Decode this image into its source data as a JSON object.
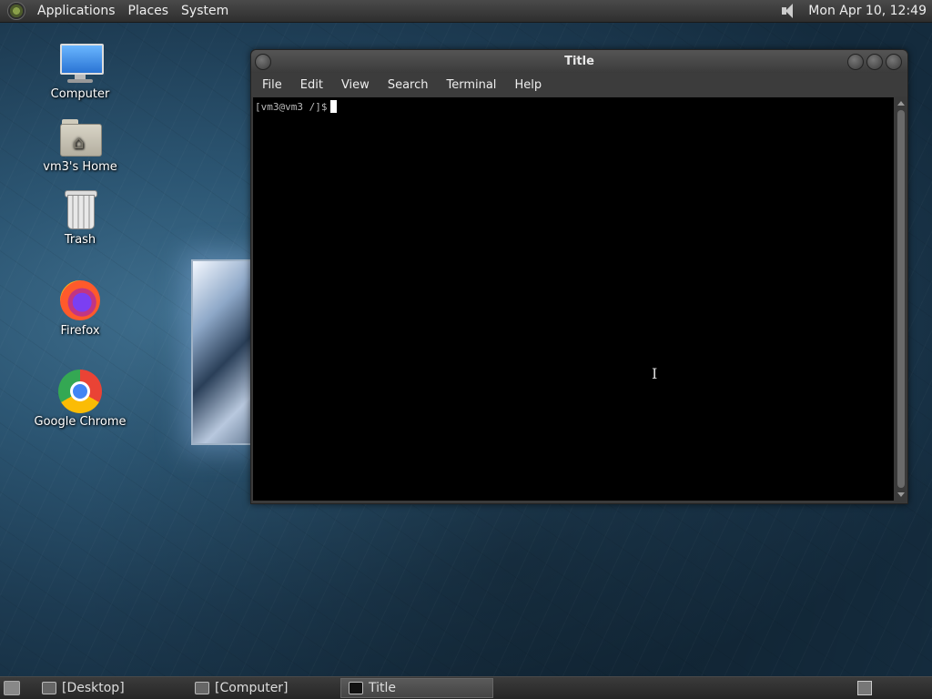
{
  "top_panel": {
    "menus": [
      "Applications",
      "Places",
      "System"
    ],
    "clock": "Mon Apr 10, 12:49"
  },
  "desktop_icons": [
    {
      "label": "Computer",
      "icon": "computer-icon"
    },
    {
      "label": "vm3's Home",
      "icon": "home-folder-icon"
    },
    {
      "label": "Trash",
      "icon": "trash-icon"
    },
    {
      "label": "Firefox",
      "icon": "firefox-icon"
    },
    {
      "label": "Google Chrome",
      "icon": "chrome-icon"
    }
  ],
  "terminal": {
    "title": "Title",
    "menus": [
      "File",
      "Edit",
      "View",
      "Search",
      "Terminal",
      "Help"
    ],
    "prompt": "[vm3@vm3 /]$"
  },
  "taskbar": {
    "tasks": [
      "[Desktop]",
      "[Computer]",
      "Title"
    ],
    "active_task": "Title"
  }
}
